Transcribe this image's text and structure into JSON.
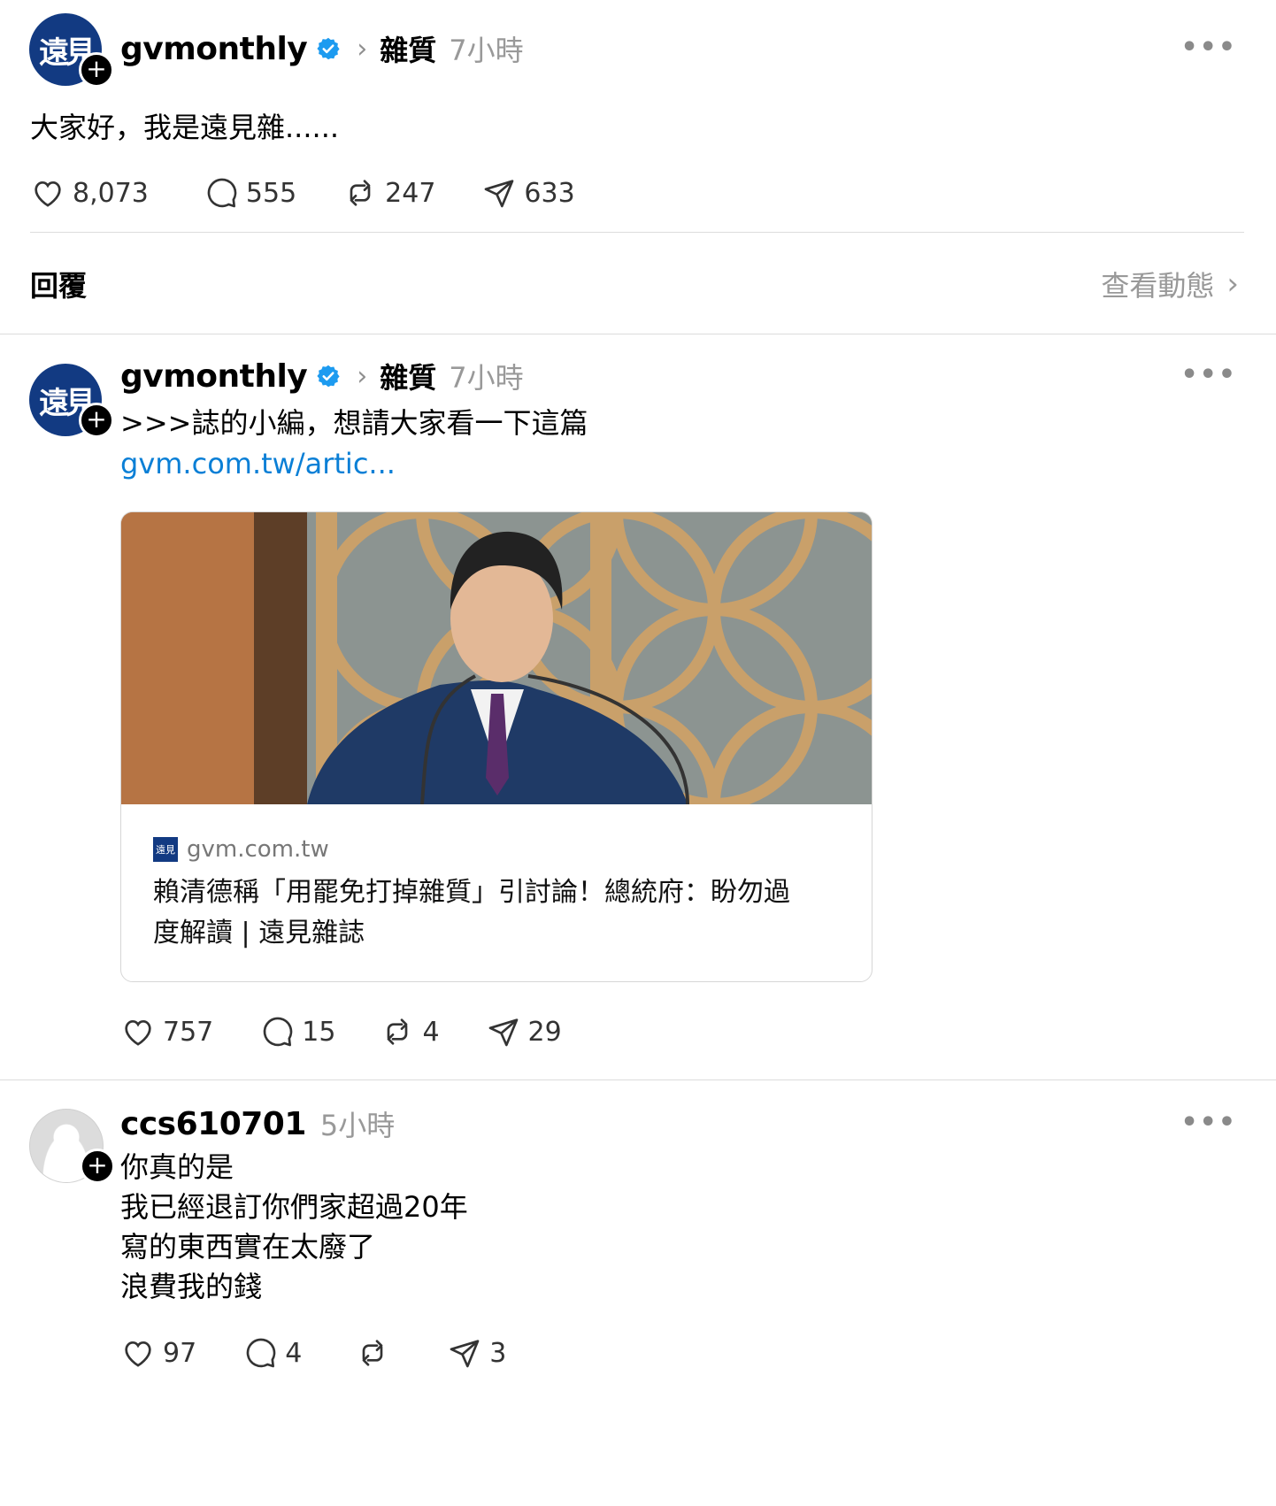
{
  "main_post": {
    "username": "gvmonthly",
    "topic": "雜質",
    "time": "7小時",
    "avatar_text": "遠見",
    "text": "大家好，我是遠見雜......",
    "likes": "8,073",
    "comments": "555",
    "reposts": "247",
    "shares": "633"
  },
  "replies_bar": {
    "label": "回覆",
    "activity": "查看動態"
  },
  "thread_post": {
    "username": "gvmonthly",
    "topic": "雜質",
    "time": "7小時",
    "avatar_text": "遠見",
    "text": ">>>誌的小編，想請大家看一下這篇",
    "link": "gvm.com.tw/artic...",
    "card": {
      "domain": "gvm.com.tw",
      "favicon_text": "遠見",
      "title_line1": "賴清德稱「用罷免打掉雜質」引討論！總統府：盼勿過",
      "title_line2": "度解讀 | 遠見雜誌"
    },
    "likes": "757",
    "comments": "15",
    "reposts": "4",
    "shares": "29"
  },
  "comment": {
    "username": "ccs610701",
    "time": "5小時",
    "lines": [
      "你真的是",
      "我已經退訂你們家超過20年",
      "寫的東西實在太廢了",
      "浪費我的錢"
    ],
    "likes": "97",
    "comments": "4",
    "reposts": "",
    "shares": "3"
  },
  "icons": {
    "like": "heart-icon",
    "comment": "comment-bubble-icon",
    "repost": "repost-icon",
    "share": "send-icon",
    "more": "more-dots-icon",
    "verified": "verified-badge-icon",
    "chevron": "chevron-right-icon"
  },
  "colors": {
    "verified": "#1d9bf0",
    "link": "#0a7fd6",
    "brand_avatar": "#123a82"
  }
}
